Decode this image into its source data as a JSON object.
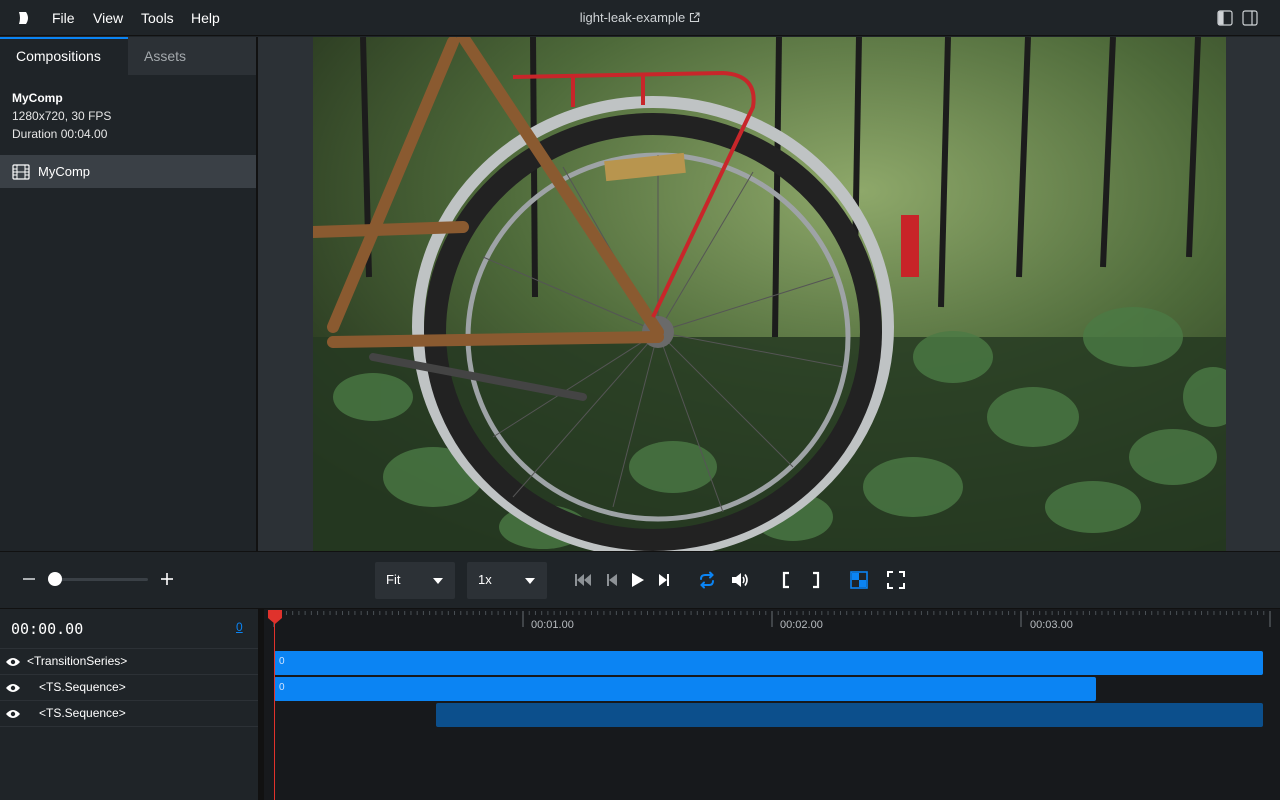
{
  "menu": {
    "items": [
      "File",
      "View",
      "Tools",
      "Help"
    ]
  },
  "window": {
    "title": "light-leak-example"
  },
  "sidebar": {
    "tabs": [
      "Compositions",
      "Assets"
    ],
    "composition": {
      "name": "MyComp",
      "resolution": "1280x720, 30 FPS",
      "duration": "Duration 00:04.00"
    },
    "list": [
      {
        "label": "MyComp",
        "icon": "film-icon"
      }
    ]
  },
  "controls": {
    "zoom_fraction": 0.05,
    "fit_value": "Fit",
    "rate_value": "1x",
    "loop_color": "#0b84f3",
    "checker_color": "#0b84f3"
  },
  "timeline": {
    "timecode": "00:00.00",
    "frame": "0",
    "ticks": [
      "00:01.00",
      "00:02.00",
      "00:03.00"
    ],
    "tracks": [
      {
        "name": "<TransitionSeries>",
        "start_sec": 0,
        "end_sec": 3.97,
        "color": "#0b84f3",
        "label": "0"
      },
      {
        "name": "<TS.Sequence>",
        "start_sec": 0,
        "end_sec": 3.3,
        "color": "#0b84f3",
        "label": "0"
      },
      {
        "name": "<TS.Sequence>",
        "start_sec": 0.65,
        "end_sec": 3.97,
        "color": "#0c4f8c",
        "label": ""
      }
    ],
    "playhead_sec": 0,
    "playhead_color": "#e0322c"
  }
}
